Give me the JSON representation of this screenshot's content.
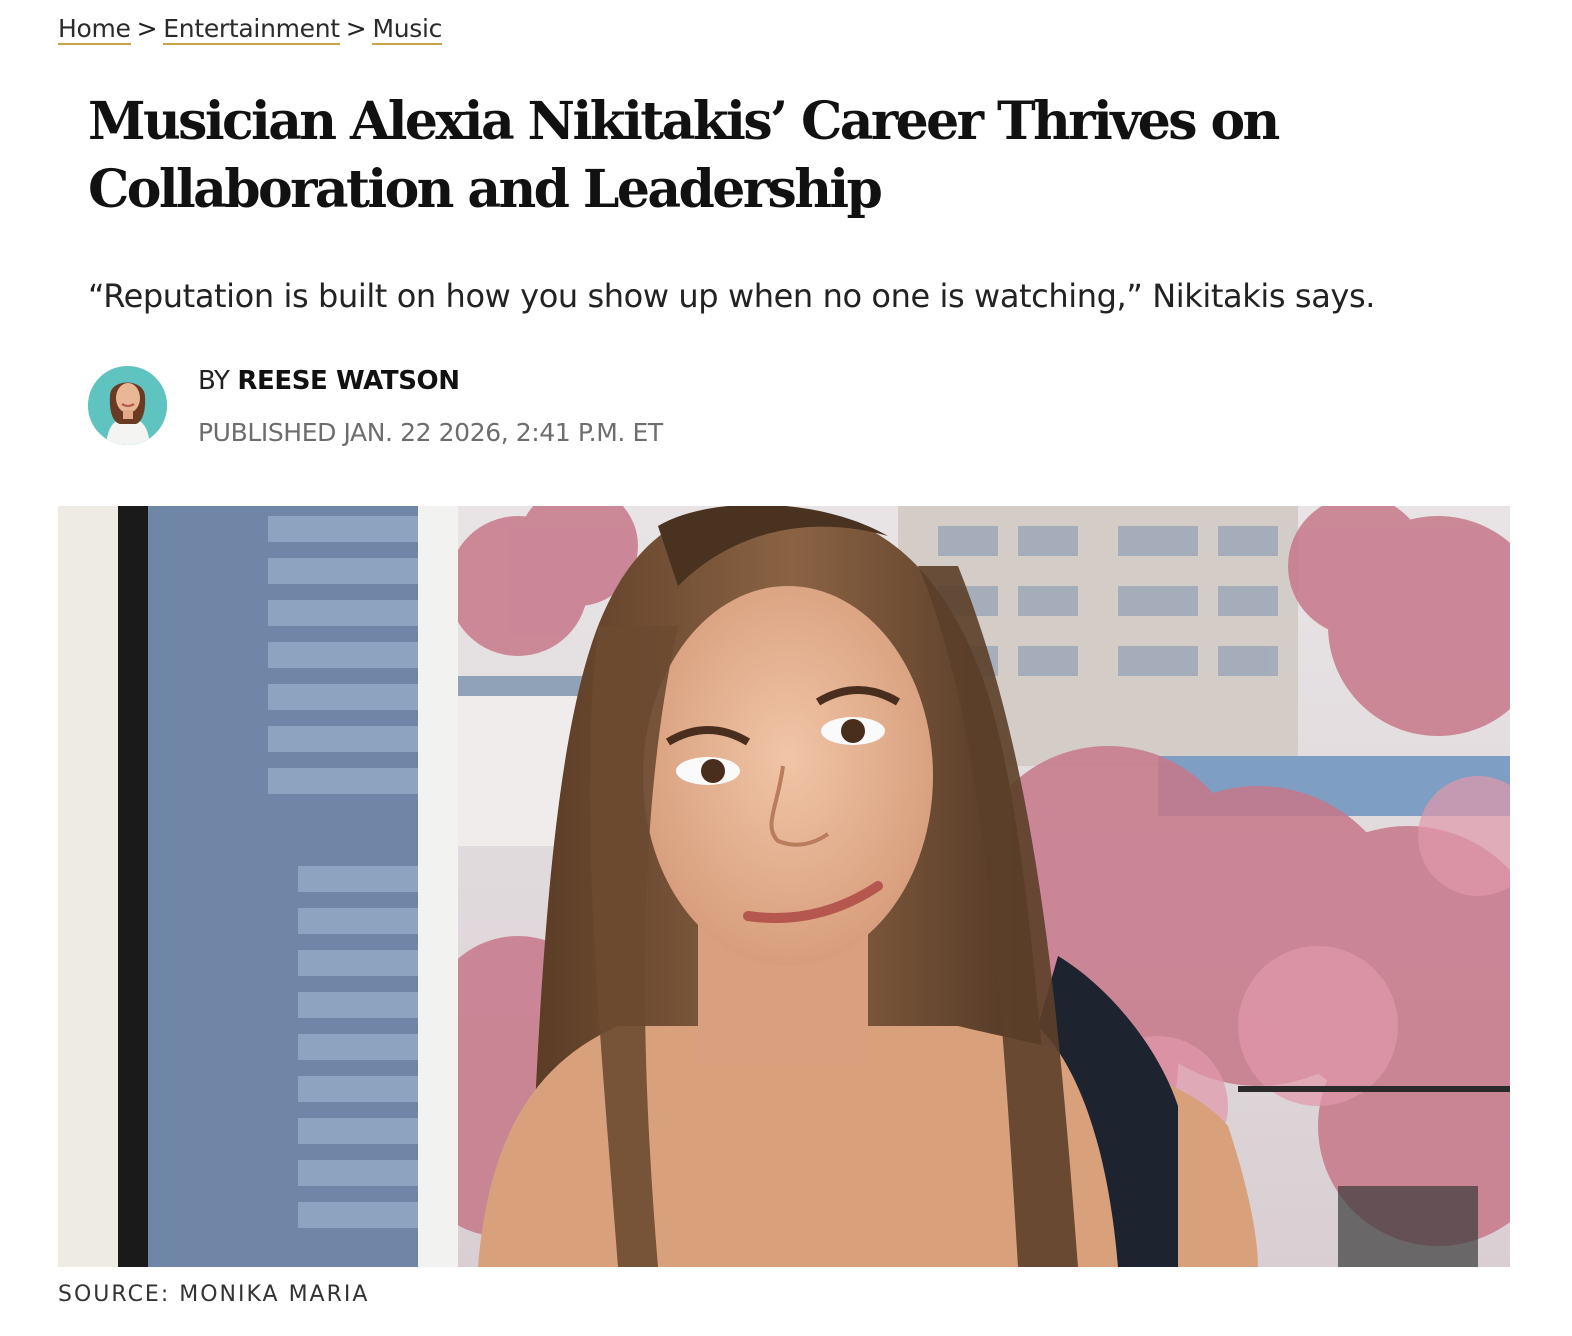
{
  "breadcrumb": {
    "items": [
      "Home",
      "Entertainment",
      "Music"
    ],
    "separator": ">"
  },
  "article": {
    "headline": "Musician Alexia Nikitakis’ Career Thrives on Collaboration and Leadership",
    "dek": "“Reputation is built on how you show up when no one is watching,” Nikitakis says.",
    "byline_prefix": "BY",
    "author": "REESE WATSON",
    "published": "PUBLISHED JAN. 22 2026, 2:41 P.M. ET",
    "image_caption": "SOURCE: MONIKA MARIA"
  },
  "colors": {
    "link_underline": "#c9a24a",
    "avatar_bg": "#5fc3bf",
    "muted_text": "#6d6d6d"
  }
}
